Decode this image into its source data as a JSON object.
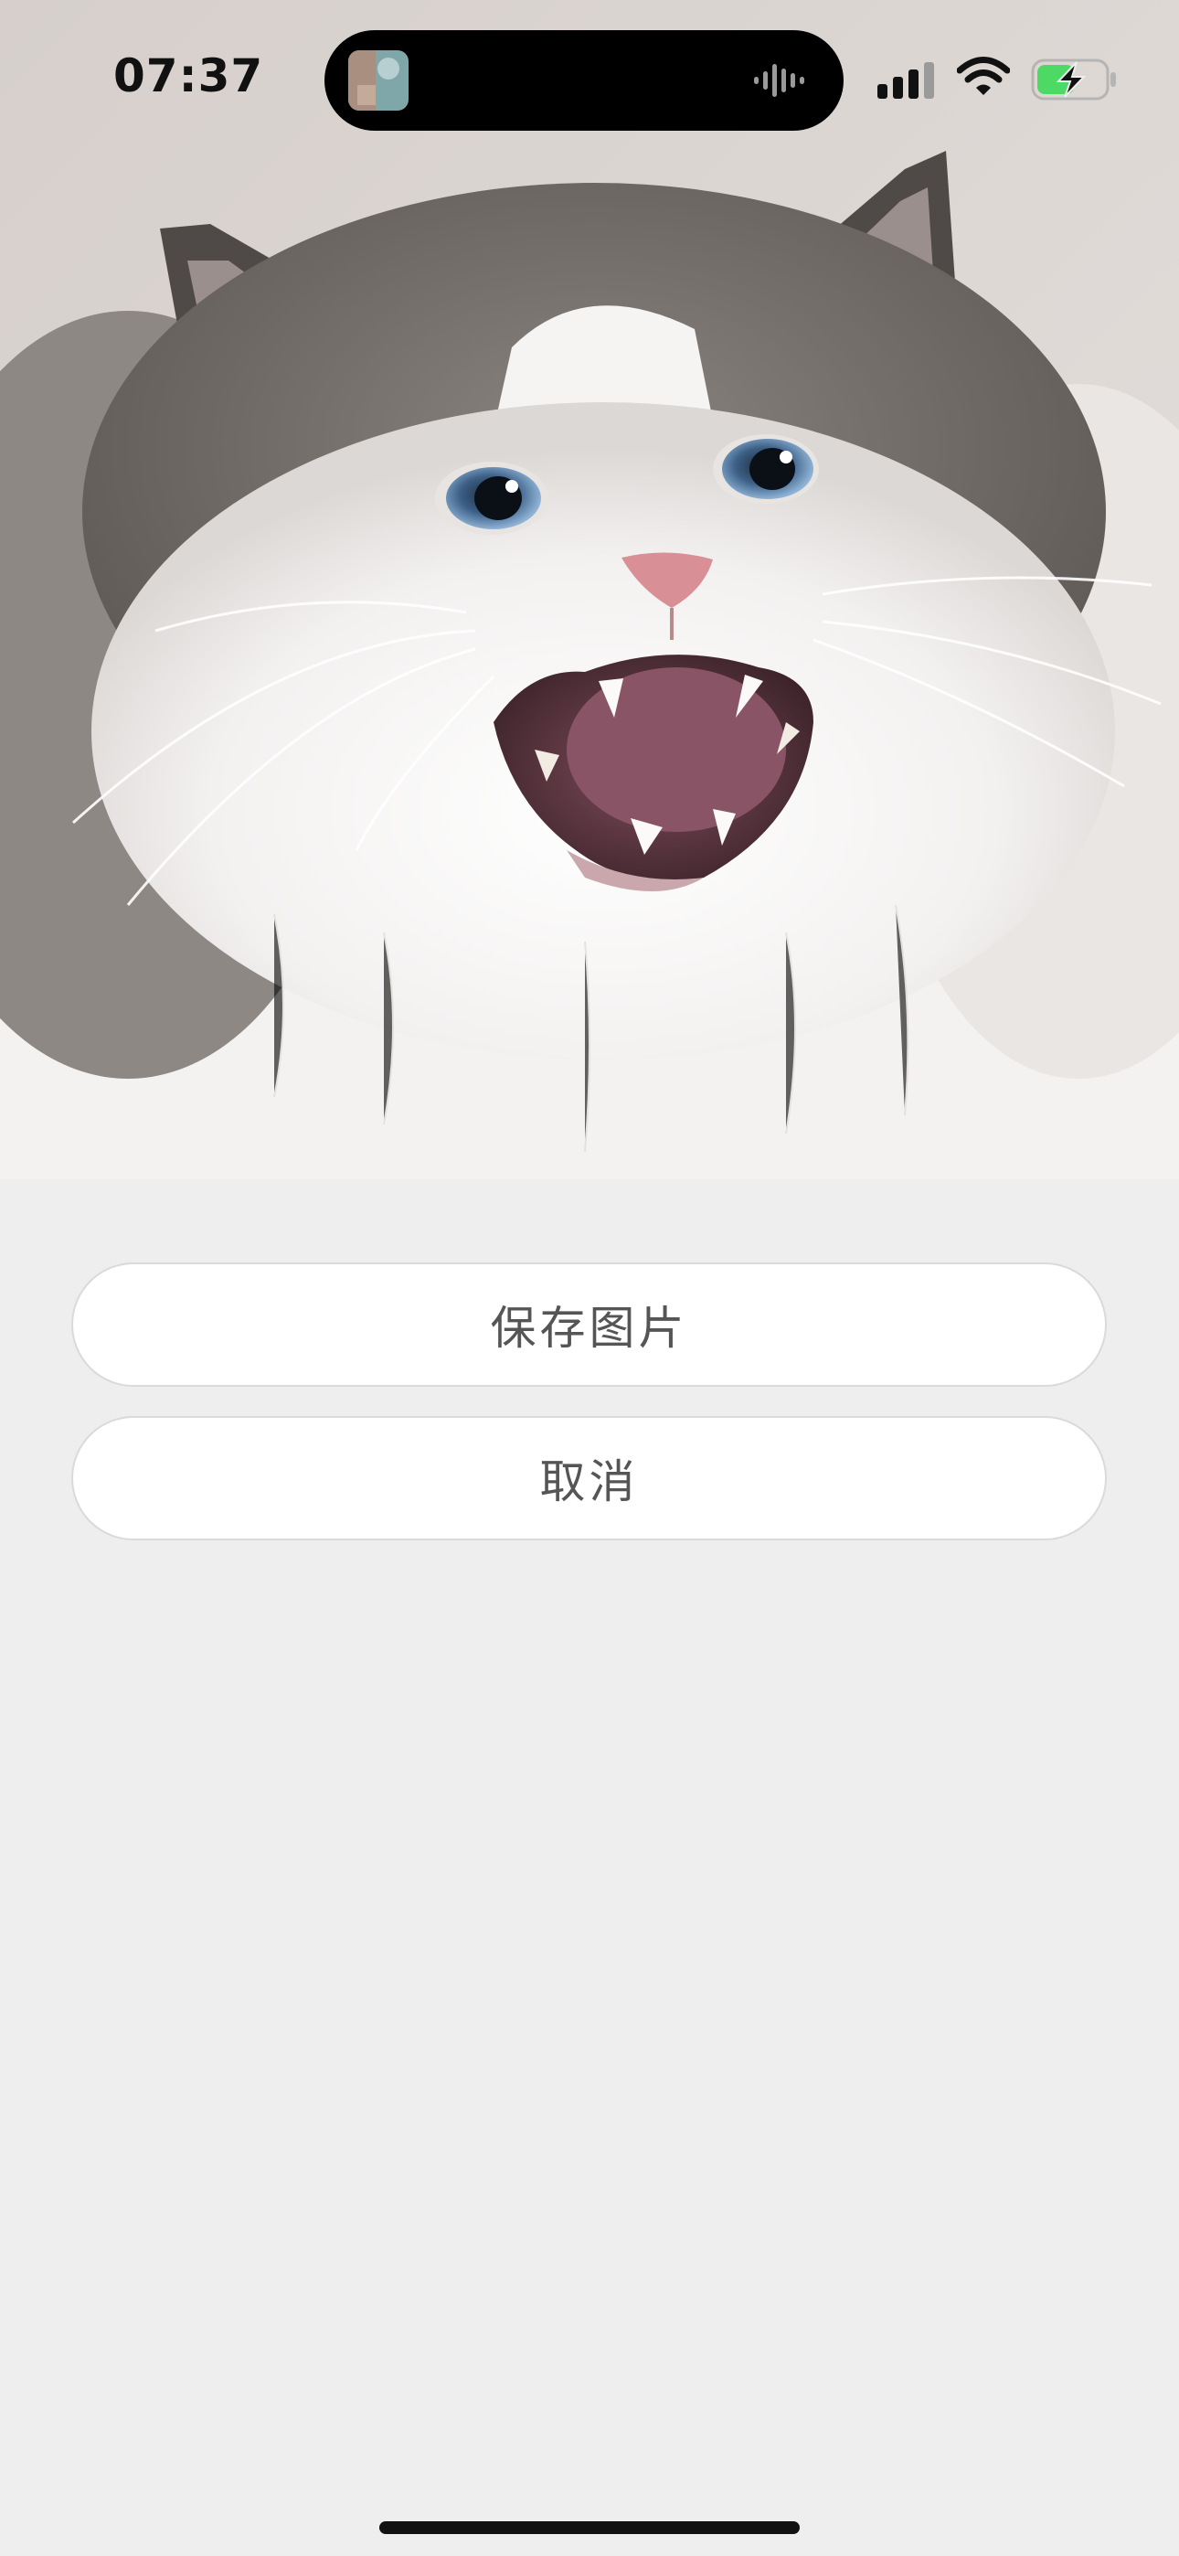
{
  "status_bar": {
    "time": "07:37",
    "icons": [
      "signal-icon",
      "wifi-icon",
      "battery-charging-icon"
    ],
    "battery_color": "#4cd964"
  },
  "photo": {
    "subject": "cat"
  },
  "action_sheet": {
    "save_label": "保存图片",
    "cancel_label": "取消"
  },
  "colors": {
    "background": "#eeeeee",
    "button_background": "#ffffff",
    "button_text": "#555555"
  }
}
